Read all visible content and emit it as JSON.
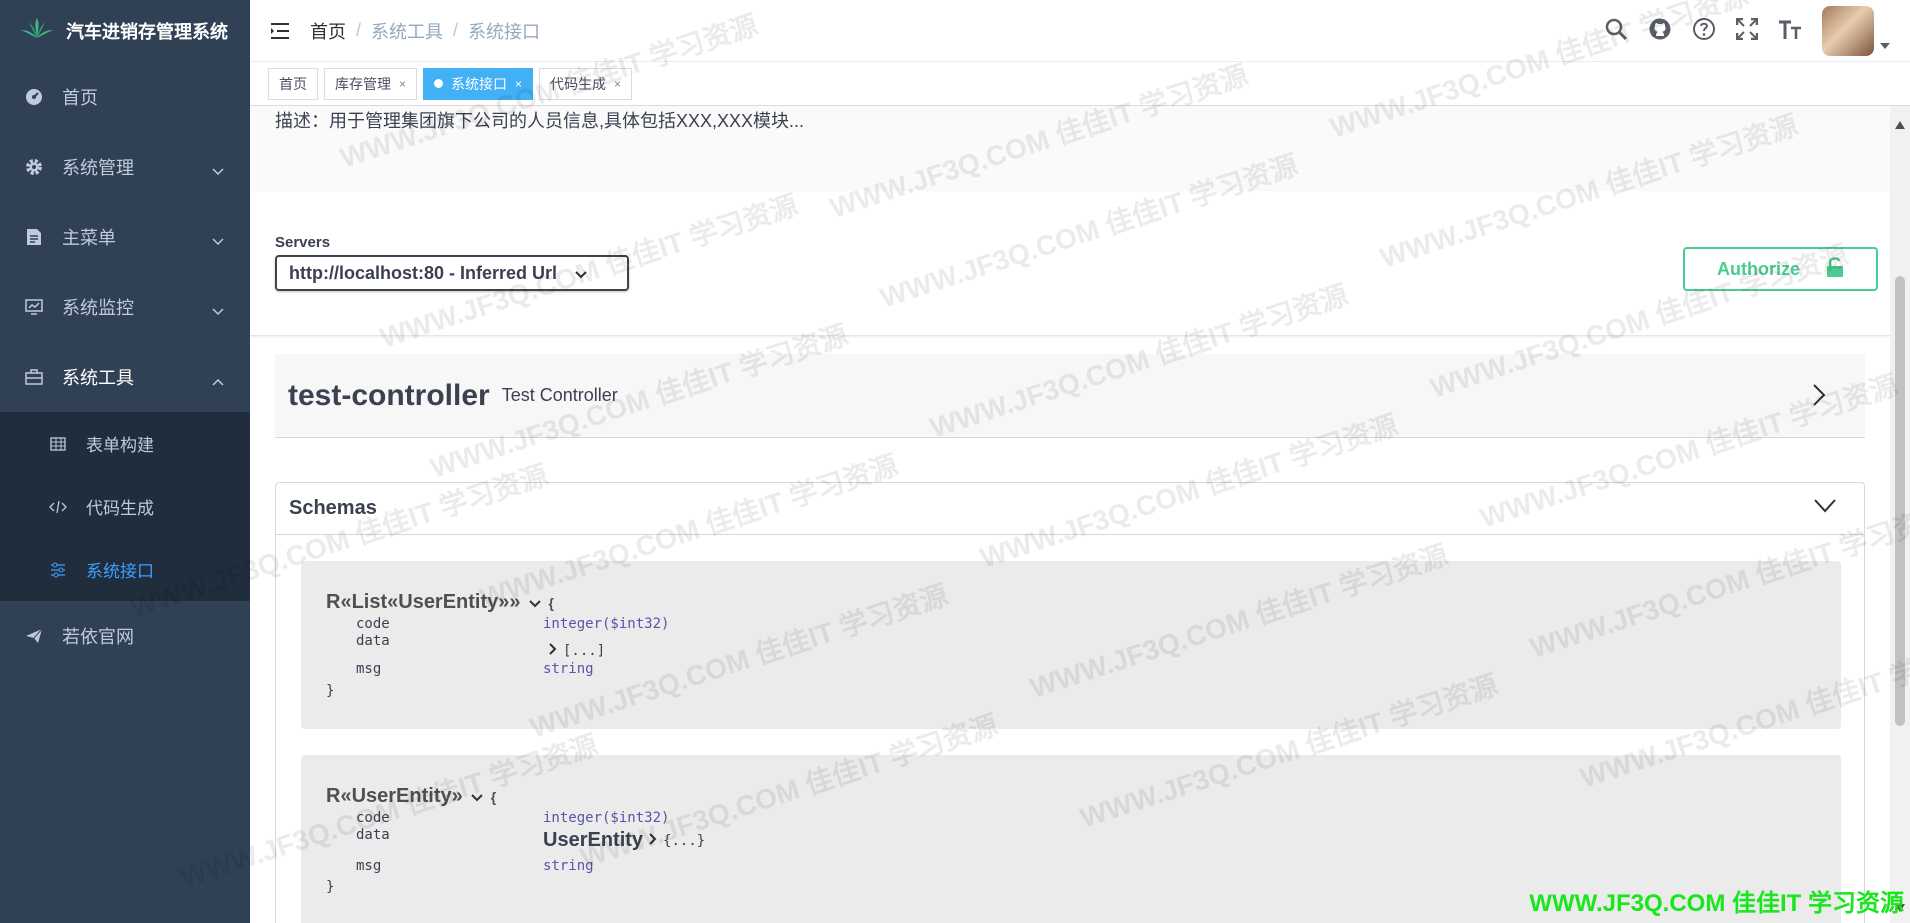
{
  "app": {
    "title": "汽车进销存管理系统"
  },
  "sidebar": {
    "items": [
      {
        "label": "首页",
        "icon": "dashboard-icon"
      },
      {
        "label": "系统管理",
        "icon": "gear-icon"
      },
      {
        "label": "主菜单",
        "icon": "document-icon"
      },
      {
        "label": "系统监控",
        "icon": "monitor-icon"
      },
      {
        "label": "系统工具",
        "icon": "toolbox-icon"
      }
    ],
    "submenu": [
      {
        "label": "表单构建",
        "icon": "table-icon"
      },
      {
        "label": "代码生成",
        "icon": "code-icon"
      },
      {
        "label": "系统接口",
        "icon": "sliders-icon",
        "active": true
      }
    ],
    "last_item": {
      "label": "若依官网",
      "icon": "paper-plane-icon"
    }
  },
  "header": {
    "breadcrumb": [
      "首页",
      "系统工具",
      "系统接口"
    ],
    "separator": "/"
  },
  "tags": [
    {
      "label": "首页",
      "closable": false,
      "active": false
    },
    {
      "label": "库存管理",
      "closable": true,
      "active": false
    },
    {
      "label": "系统接口",
      "closable": true,
      "active": true
    },
    {
      "label": "代码生成",
      "closable": true,
      "active": false
    }
  ],
  "tag_close": "×",
  "swagger": {
    "description": "描述：用于管理集团旗下公司的人员信息,具体包括XXX,XXX模块...",
    "servers_label": "Servers",
    "server_value": "http://localhost:80 - Inferred Url",
    "authorize_label": "Authorize",
    "controller": {
      "name": "test-controller",
      "description": "Test Controller"
    },
    "schemas_title": "Schemas",
    "models": [
      {
        "title": "R«List«UserEntity»»",
        "open_brace": "{",
        "close_brace": "}",
        "props": [
          {
            "name": "code",
            "type": "integer($int32)"
          },
          {
            "name": "data",
            "type": "[...]"
          },
          {
            "name": "msg",
            "type": "string"
          }
        ]
      },
      {
        "title": "R«UserEntity»",
        "open_brace": "{",
        "close_brace": "}",
        "props": [
          {
            "name": "code",
            "type": "integer($int32)"
          },
          {
            "name": "data",
            "ref": "UserEntity",
            "type": "{...}"
          },
          {
            "name": "msg",
            "type": "string"
          }
        ]
      }
    ]
  },
  "watermark": {
    "text": "WWW.JF3Q.COM 佳佳IT  学习资源",
    "green_text": "WWW.JF3Q.COM 佳佳IT  学习资源"
  },
  "colors": {
    "sidebar_bg": "#304156",
    "accent": "#409eff",
    "authorize": "#49cc90",
    "active_tag": "#42b0f5"
  }
}
